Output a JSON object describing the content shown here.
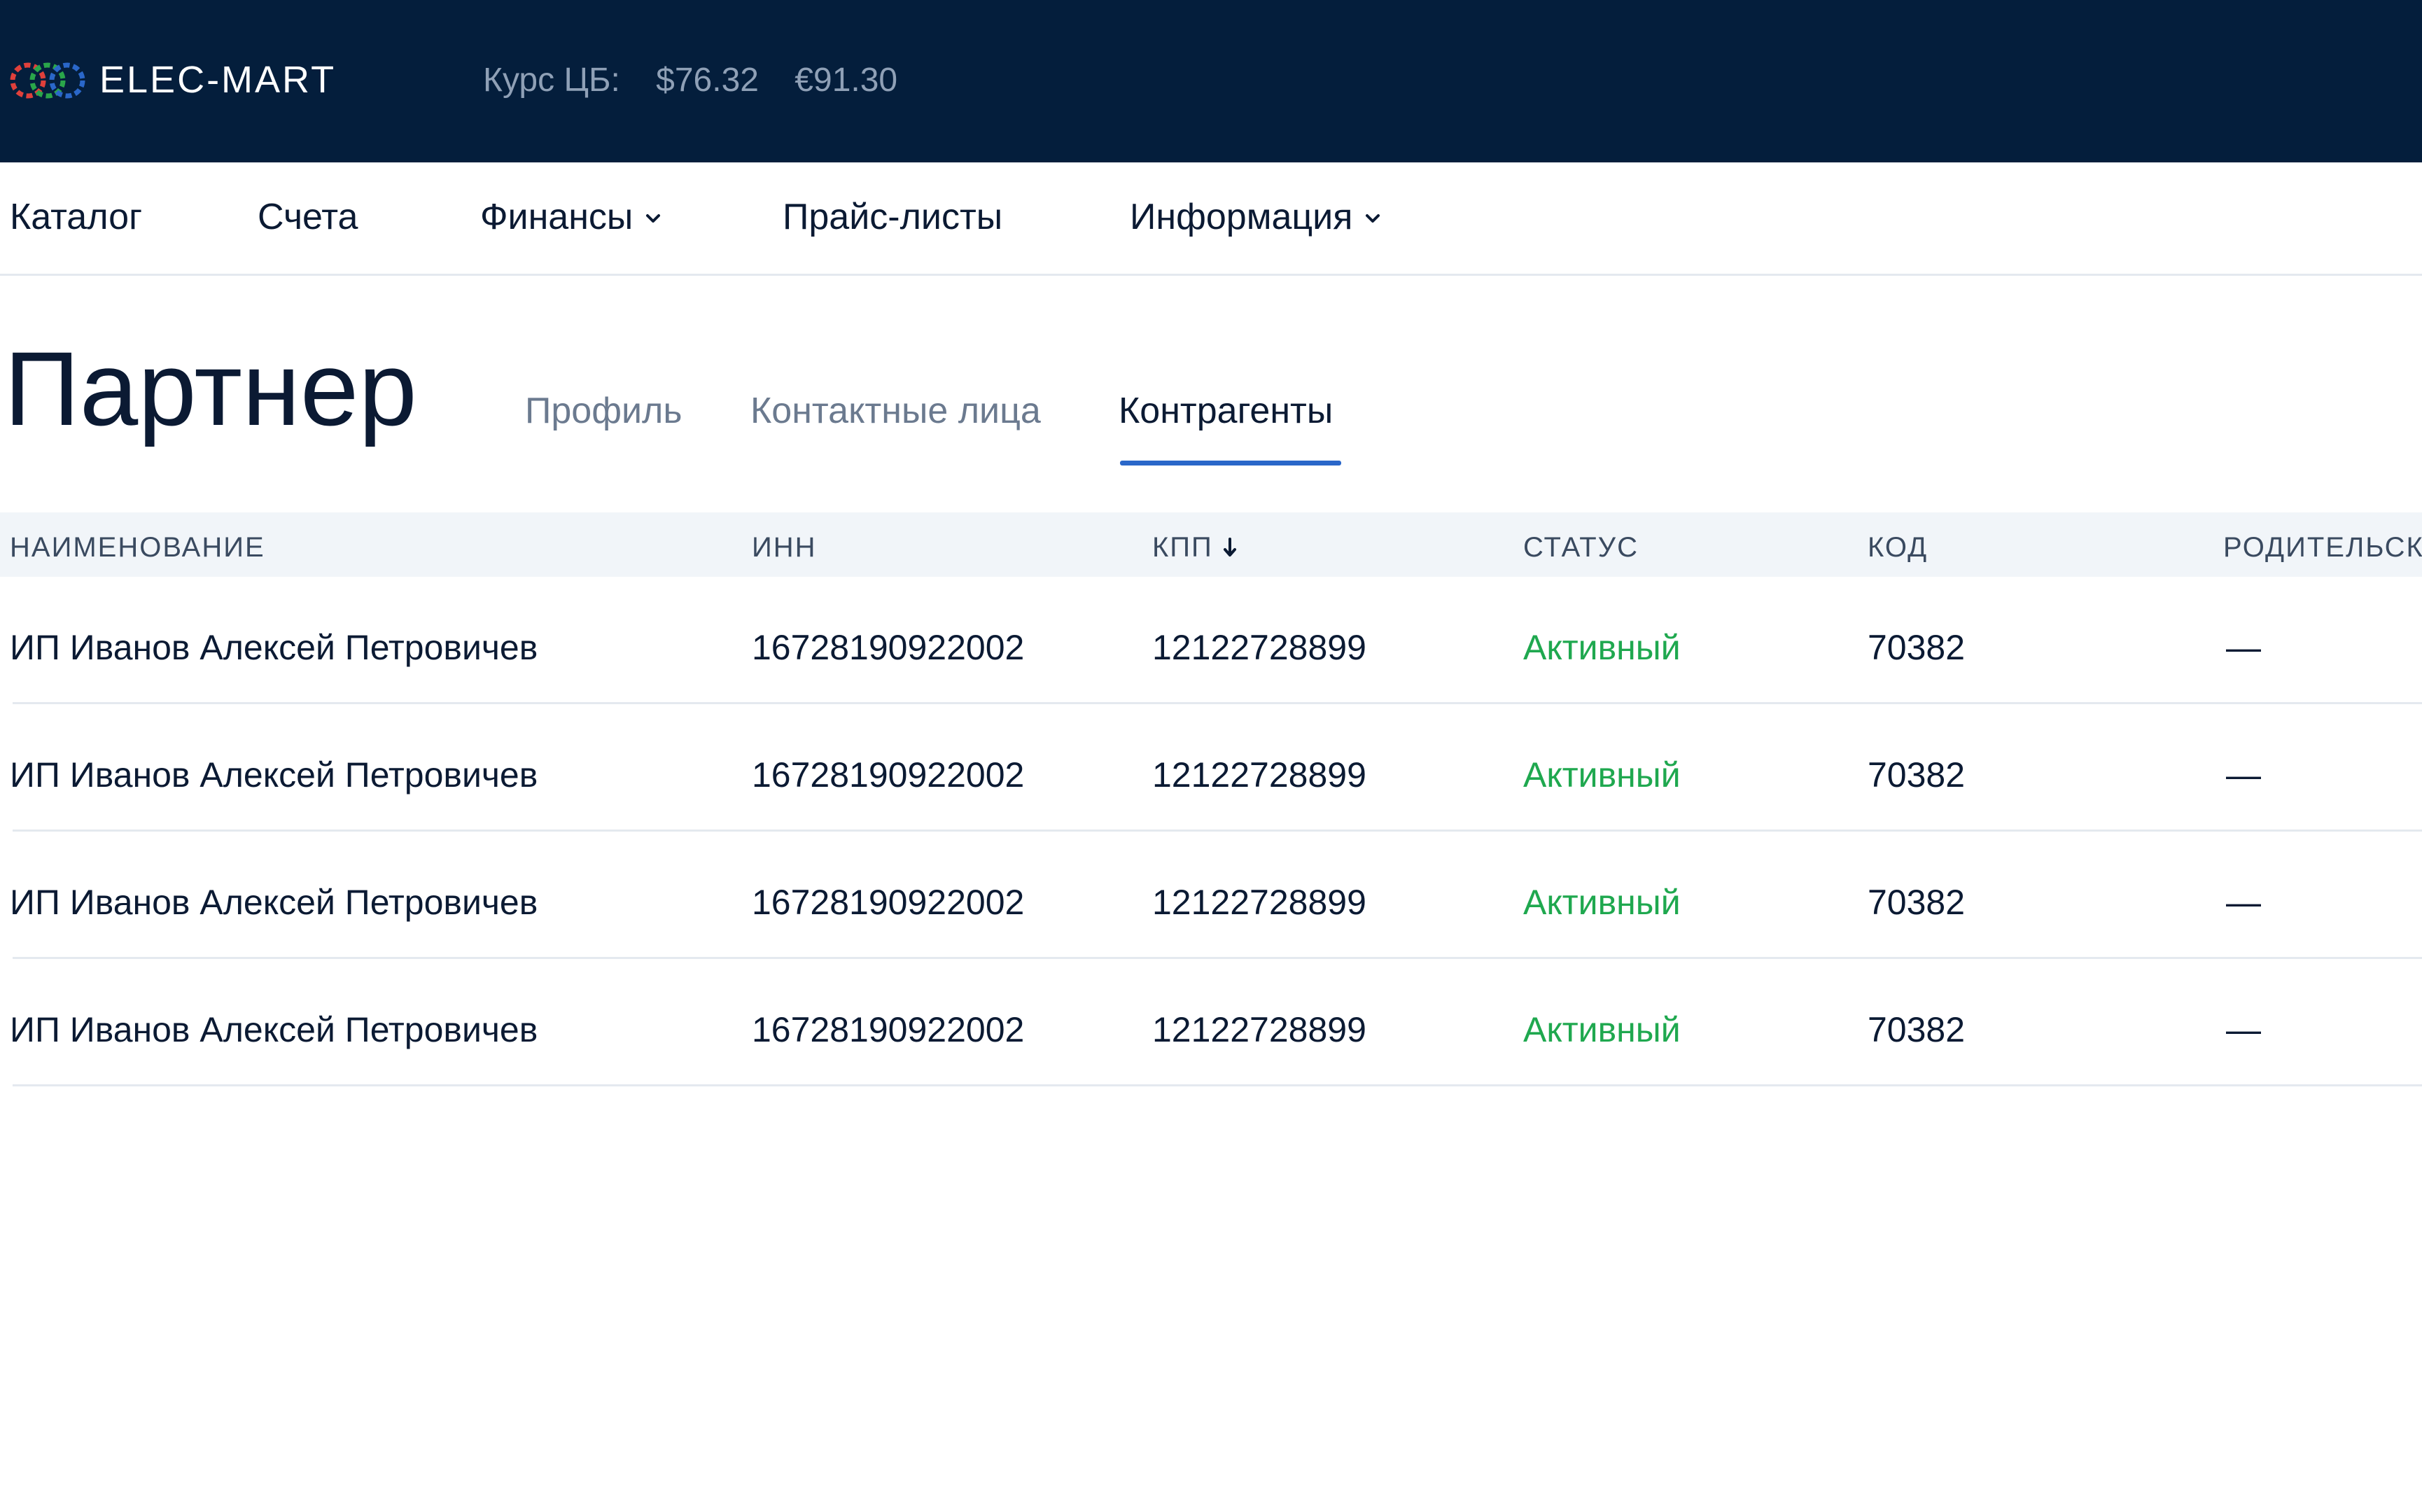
{
  "header": {
    "brand": "ELEC-MART",
    "rate_label": "Курс ЦБ:",
    "rate_usd": "$76.32",
    "rate_eur": "€91.30",
    "colors": {
      "background": "#041e3c",
      "logo_red": "#e0403b",
      "logo_green": "#2aa64a",
      "logo_blue": "#2a67c9"
    }
  },
  "nav": {
    "items": [
      {
        "label": "Каталог",
        "has_dropdown": false
      },
      {
        "label": "Счета",
        "has_dropdown": false
      },
      {
        "label": "Финансы",
        "has_dropdown": true,
        "icon": "chevron-down-icon"
      },
      {
        "label": "Прайс-листы",
        "has_dropdown": false
      },
      {
        "label": "Информация",
        "has_dropdown": true,
        "icon": "chevron-down-icon"
      }
    ]
  },
  "page": {
    "title": "Партнер",
    "tabs": [
      {
        "label": "Профиль",
        "active": false
      },
      {
        "label": "Контактные лица",
        "active": false
      },
      {
        "label": "Контрагенты",
        "active": true
      }
    ],
    "accent": "#2a67c9"
  },
  "table": {
    "columns": [
      {
        "label": "НАИМЕНОВАНИЕ"
      },
      {
        "label": "ИНН"
      },
      {
        "label": "КПП",
        "sorted": "desc",
        "icon": "sort-arrow-down-icon"
      },
      {
        "label": "СТАТУС"
      },
      {
        "label": "КОД"
      },
      {
        "label": "РОДИТЕЛЬСКА"
      }
    ],
    "rows": [
      {
        "name": "ИП Иванов Алексей Петровичев",
        "inn": "16728190922002",
        "kpp": "12122728899",
        "status": "Активный",
        "code": "70382",
        "parent": "—"
      },
      {
        "name": "ИП Иванов Алексей Петровичев",
        "inn": "16728190922002",
        "kpp": "12122728899",
        "status": "Активный",
        "code": "70382",
        "parent": "—"
      },
      {
        "name": "ИП Иванов Алексей Петровичев",
        "inn": "16728190922002",
        "kpp": "12122728899",
        "status": "Активный",
        "code": "70382",
        "parent": "—"
      },
      {
        "name": "ИП Иванов Алексей Петровичев",
        "inn": "16728190922002",
        "kpp": "12122728899",
        "status": "Активный",
        "code": "70382",
        "parent": "—"
      }
    ],
    "status_color": "#1fa84f"
  }
}
